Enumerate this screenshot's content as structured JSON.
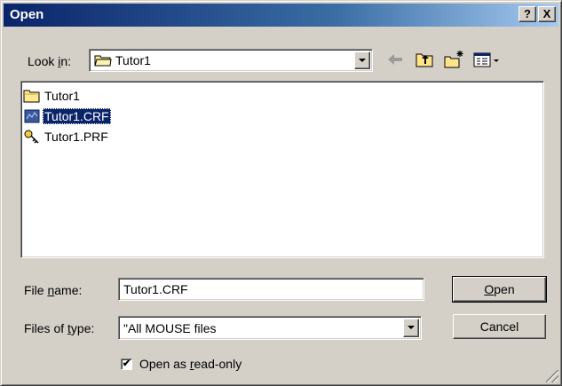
{
  "window": {
    "title": "Open"
  },
  "titlebar": {
    "help_label": "?",
    "close_label": "X"
  },
  "lookin": {
    "label_pre": "Look ",
    "label_key": "i",
    "label_post": "n:",
    "value": "Tutor1",
    "icon": "folder-icon"
  },
  "toolbar": {
    "back_icon": "back-arrow-icon",
    "up_icon": "up-folder-icon",
    "new_folder_icon": "new-folder-icon",
    "view_icon": "view-menu-icon"
  },
  "files": [
    {
      "name": "Tutor1",
      "icon": "folder-icon",
      "selected": false
    },
    {
      "name": "Tutor1.CRF",
      "icon": "crf-file-icon",
      "selected": true
    },
    {
      "name": "Tutor1.PRF",
      "icon": "prf-file-icon",
      "selected": false
    }
  ],
  "filename": {
    "label_pre": "File ",
    "label_key": "n",
    "label_post": "ame:",
    "value": "Tutor1.CRF"
  },
  "filetype": {
    "label_pre": "Files of ",
    "label_key": "t",
    "label_post": "ype:",
    "value": "\"All MOUSE files"
  },
  "buttons": {
    "open_key": "O",
    "open_rest": "pen",
    "cancel": "Cancel"
  },
  "readonly": {
    "checked": true,
    "check_glyph": "✔",
    "label_pre": "Open as ",
    "label_key": "r",
    "label_post": "ead-only"
  },
  "colors": {
    "titlebar_start": "#0a246a",
    "titlebar_end": "#a6caf0",
    "selection": "#0a246a",
    "face": "#d4d0c8"
  }
}
